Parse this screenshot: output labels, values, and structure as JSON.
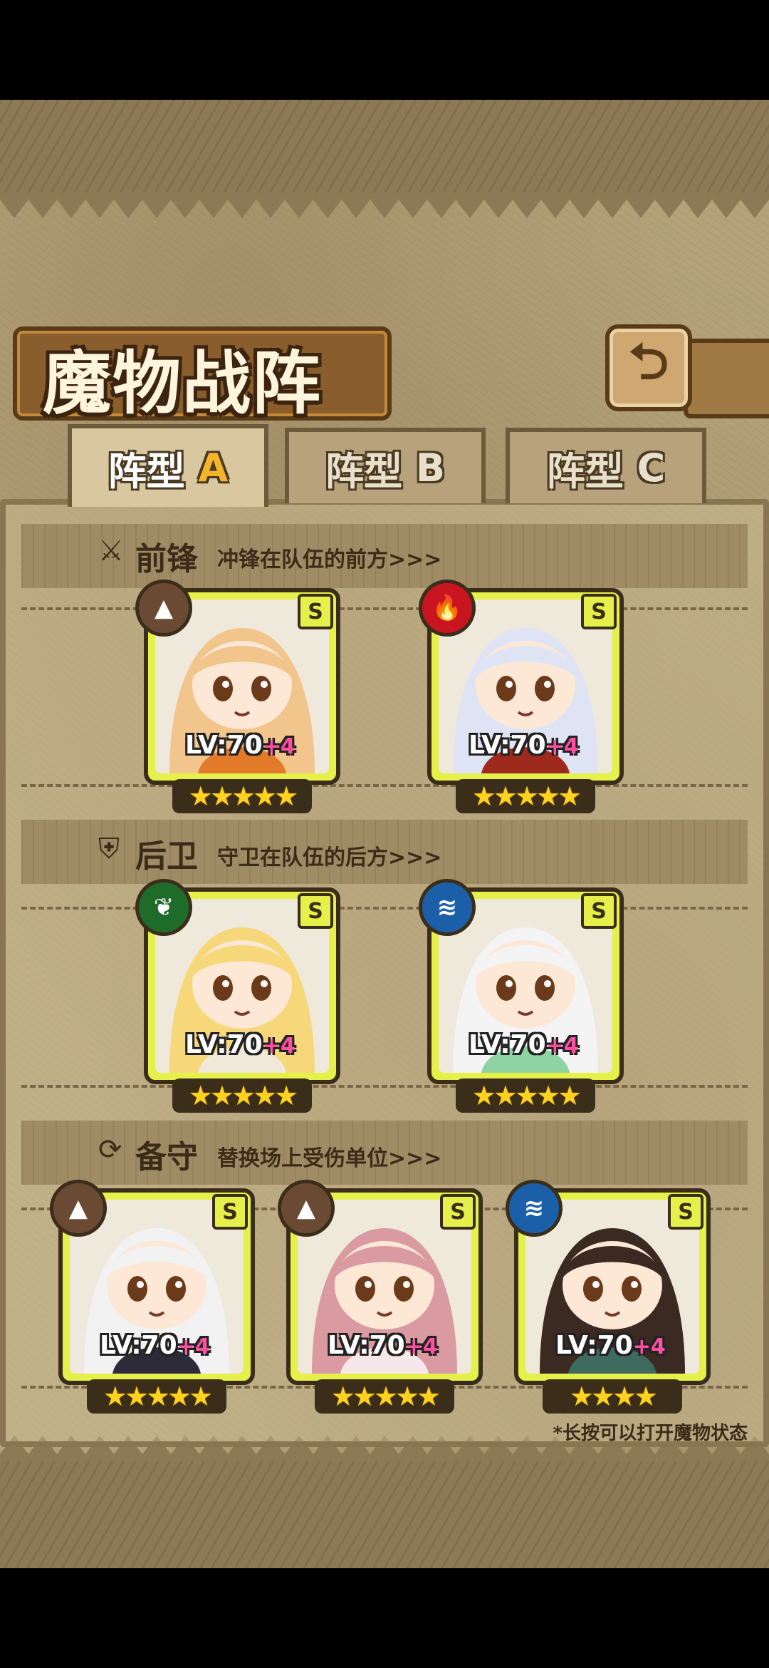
{
  "header": {
    "title": "魔物战阵",
    "back_icon": "return-arrow-icon"
  },
  "tabs": [
    {
      "label": "阵型",
      "letter": "A",
      "active": true
    },
    {
      "label": "阵型",
      "letter": "B",
      "active": false
    },
    {
      "label": "阵型",
      "letter": "C",
      "active": false
    }
  ],
  "sections": [
    {
      "title": "前锋",
      "desc": "冲锋在队伍的前方>>>",
      "icon": "sword-icon"
    },
    {
      "title": "后卫",
      "desc": "守卫在队伍的后方>>>",
      "icon": "shield-icon"
    },
    {
      "title": "备守",
      "desc": "替换场上受伤单位>>>",
      "icon": "swap-icon"
    }
  ],
  "cards": {
    "front": [
      {
        "level": "LV:70",
        "plus": "+4",
        "rank": "S",
        "element": "earth",
        "element_color": "#6b4a33",
        "stars": 5,
        "hair": "#f2c58c",
        "accent": "#e37a2a"
      },
      {
        "level": "LV:70",
        "plus": "+4",
        "rank": "S",
        "element": "fire",
        "element_color": "#c8151f",
        "stars": 5,
        "hair": "#dfe4f4",
        "accent": "#9e2a1d"
      }
    ],
    "back": [
      {
        "level": "LV:70",
        "plus": "+4",
        "rank": "S",
        "element": "nature",
        "element_color": "#1f6b2a",
        "stars": 5,
        "hair": "#f6d77a",
        "accent": "#f0e8d8"
      },
      {
        "level": "LV:70",
        "plus": "+4",
        "rank": "S",
        "element": "water",
        "element_color": "#1a5fa8",
        "stars": 5,
        "hair": "#f4f4f4",
        "accent": "#8fd3a2"
      }
    ],
    "reserve": [
      {
        "level": "LV:70",
        "plus": "+4",
        "rank": "S",
        "element": "earth",
        "element_color": "#6b4a33",
        "stars": 5,
        "hair": "#f2f2f2",
        "accent": "#2d2a3a"
      },
      {
        "level": "LV:70",
        "plus": "+4",
        "rank": "S",
        "element": "earth",
        "element_color": "#6b4a33",
        "stars": 5,
        "hair": "#d99aa2",
        "accent": "#f5e7ea"
      },
      {
        "level": "LV:70",
        "plus": "+4",
        "rank": "S",
        "element": "water",
        "element_color": "#1a5fa8",
        "stars": 4,
        "hair": "#3a2a22",
        "accent": "#3f6a5e"
      }
    ]
  },
  "hint": "*长按可以打开魔物状态"
}
